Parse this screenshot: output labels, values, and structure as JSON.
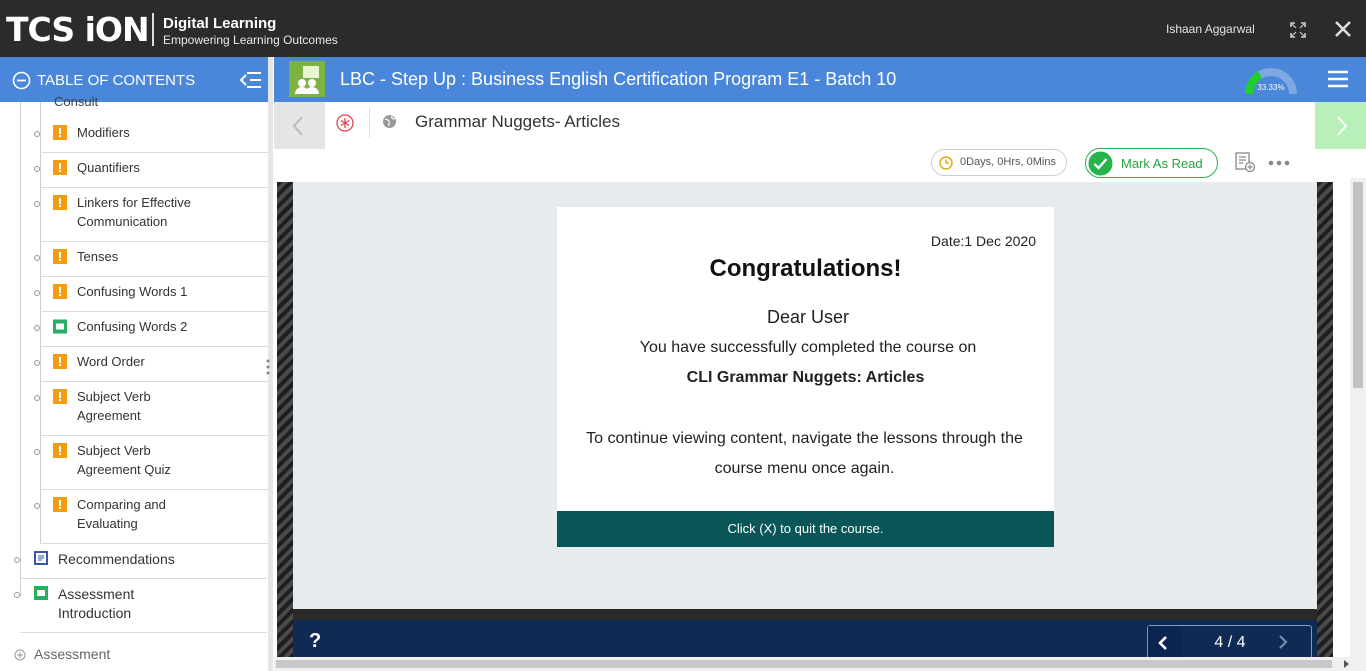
{
  "header": {
    "logo_text": "TCS iON",
    "brand_title": "Digital Learning",
    "brand_subtitle": "Empowering Learning Outcomes",
    "username": "Ishaan Aggarwal"
  },
  "toc": {
    "title": "TABLE OF CONTENTS",
    "partial_item": "Consult",
    "sub_items": [
      {
        "label_lines": [
          "Modifiers"
        ],
        "icon": "quiz-icon"
      },
      {
        "label_lines": [
          "Quantifiers"
        ],
        "icon": "quiz-icon"
      },
      {
        "label_lines": [
          "Linkers for Effective",
          "Communication"
        ],
        "icon": "quiz-icon"
      },
      {
        "label_lines": [
          "Tenses"
        ],
        "icon": "quiz-icon"
      },
      {
        "label_lines": [
          "Confusing Words 1"
        ],
        "icon": "quiz-icon"
      },
      {
        "label_lines": [
          "Confusing Words 2"
        ],
        "icon": "video-icon"
      },
      {
        "label_lines": [
          "Word Order"
        ],
        "icon": "quiz-icon"
      },
      {
        "label_lines": [
          "Subject Verb",
          "Agreement"
        ],
        "icon": "quiz-icon"
      },
      {
        "label_lines": [
          "Subject Verb",
          "Agreement Quiz"
        ],
        "icon": "quiz-icon"
      },
      {
        "label_lines": [
          "Comparing and",
          "Evaluating"
        ],
        "icon": "quiz-icon"
      }
    ],
    "top_items": [
      {
        "label_lines": [
          "Recommendations"
        ],
        "icon": "document-icon"
      },
      {
        "label_lines": [
          "Assessment",
          "Introduction"
        ],
        "icon": "video-icon"
      }
    ],
    "section": "Assessment"
  },
  "course": {
    "title": "LBC - Step Up : Business English Certification Program E1 - Batch 10",
    "progress_text": "33.33%",
    "progress_fraction": 0.3333
  },
  "lesson": {
    "title": "Grammar Nuggets- Articles",
    "timer": "0Days, 0Hrs, 0Mins",
    "mark_read": "Mark As Read"
  },
  "card": {
    "date": "Date:1 Dec 2020",
    "heading": "Congratulations!",
    "dear": "Dear User",
    "message": "You have successfully completed the course on",
    "course_name": "CLI Grammar Nuggets: Articles",
    "continue_line1": "To continue viewing content, navigate the lessons through the",
    "continue_line2": "course menu once again.",
    "footer": "Click (X) to quit the course."
  },
  "player": {
    "help": "?",
    "pager": "4 / 4"
  },
  "colors": {
    "header_bg": "#2b2b2b",
    "accent_blue": "#4a86d9",
    "quiz_orange": "#f39c12",
    "video_green": "#27ae60",
    "footer_teal": "#0a5558",
    "player_navy": "#0e2a55",
    "mark_read_green": "#26b34a",
    "next_green": "#b9f0b9"
  }
}
